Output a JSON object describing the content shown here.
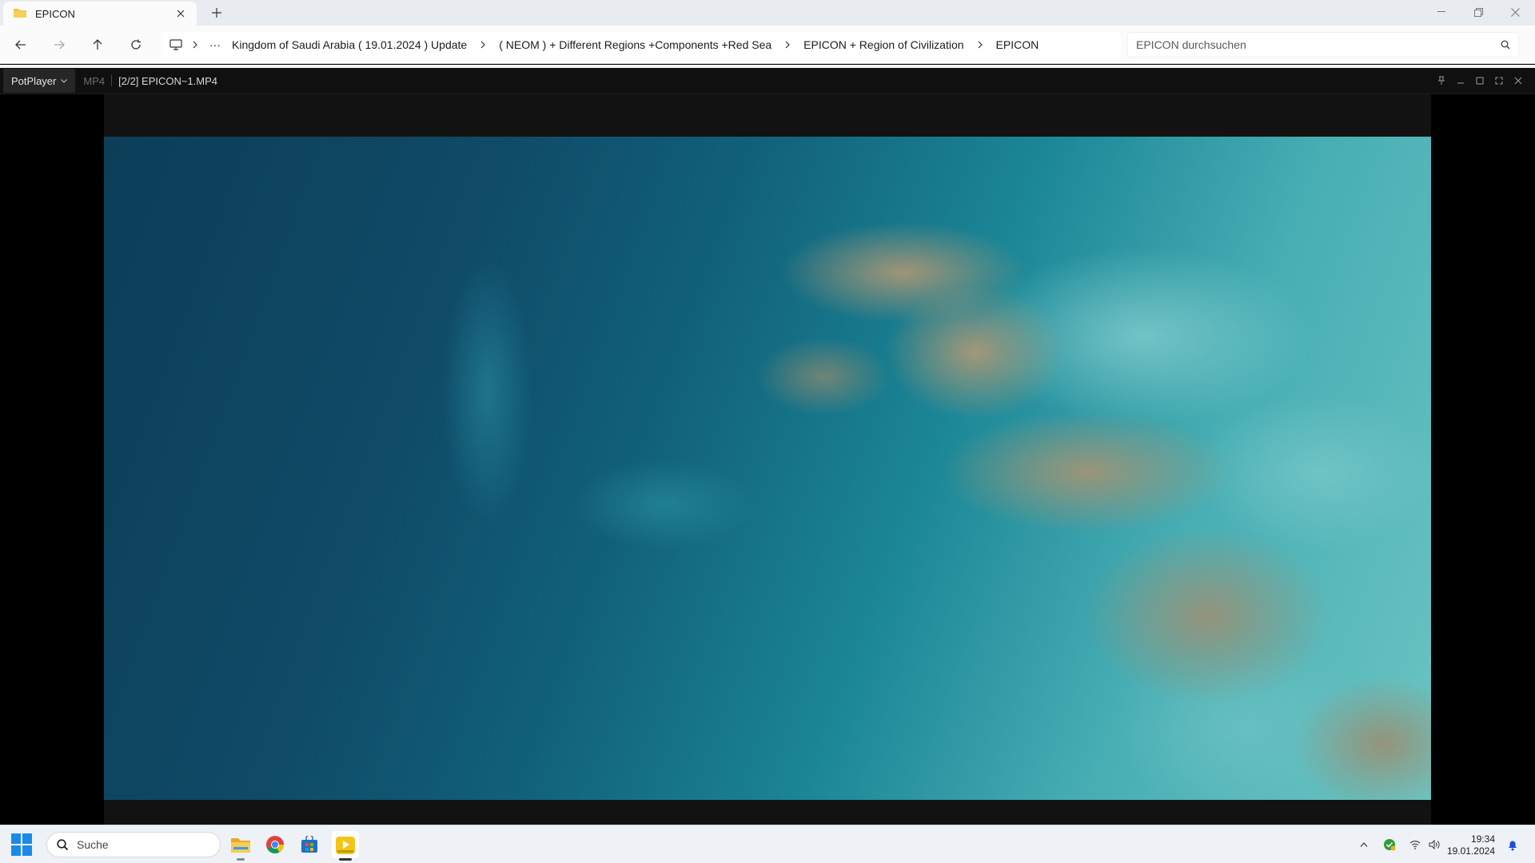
{
  "explorer": {
    "tab_title": "EPICON",
    "search_placeholder": "EPICON durchsuchen",
    "breadcrumbs": [
      "Kingdom of Saudi Arabia ( 19.01.2024 ) Update",
      "( NEOM ) + Different Regions +Components +Red Sea",
      "EPICON + Region of Civilization",
      "EPICON"
    ],
    "overflow_label": "···"
  },
  "player": {
    "menu_label": "PotPlayer",
    "format": "MP4",
    "file_title": "[2/2] EPICON~1.MP4"
  },
  "taskbar": {
    "search_label": "Suche",
    "clock_time": "19:34",
    "clock_date": "19.01.2024",
    "accent_color": "#1a8ae8"
  }
}
